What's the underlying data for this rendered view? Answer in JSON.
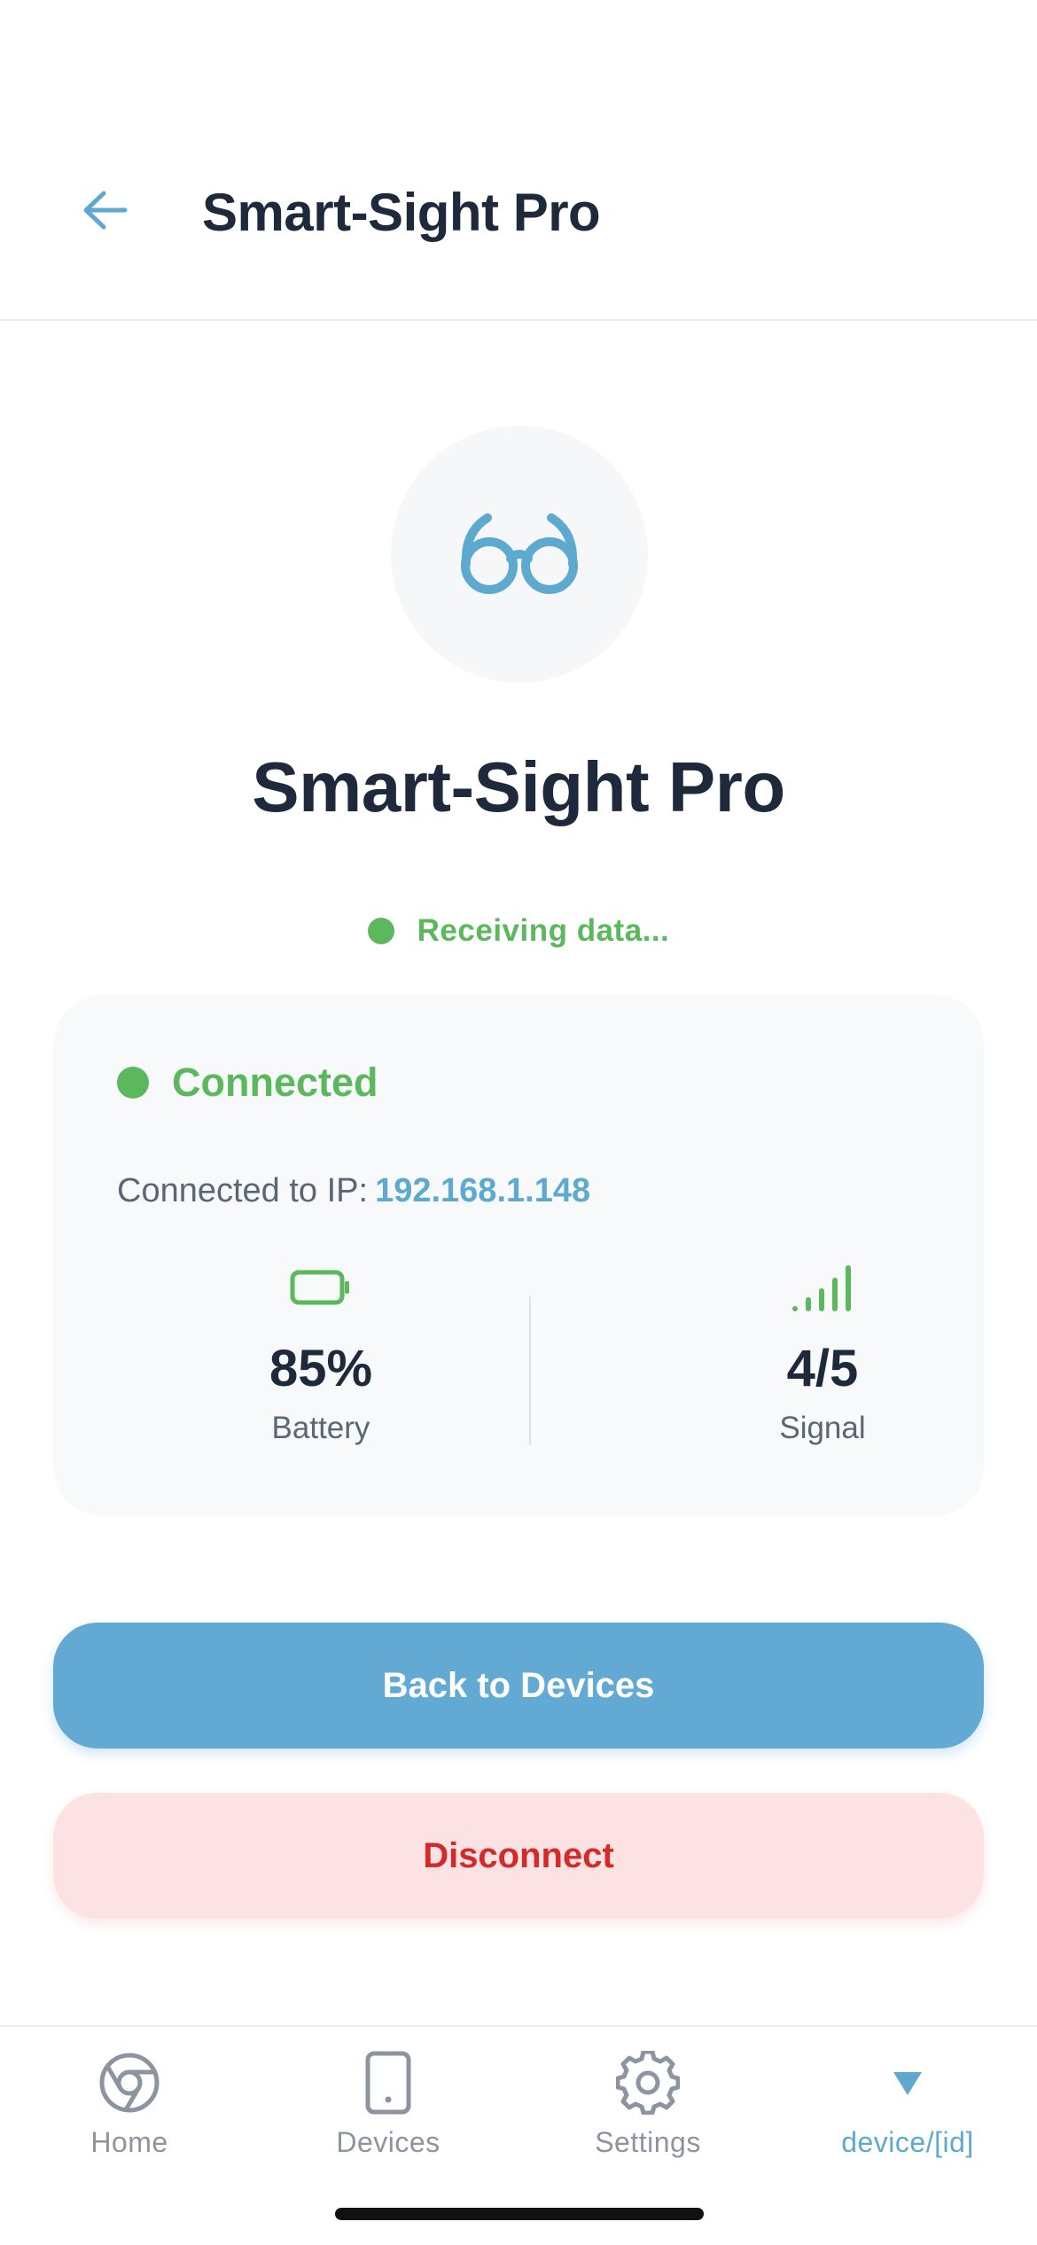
{
  "header": {
    "title": "Smart-Sight Pro",
    "back_icon": "arrow-left-icon"
  },
  "device": {
    "icon": "glasses-icon",
    "name": "Smart-Sight Pro",
    "data_status": "Receiving data..."
  },
  "status_card": {
    "connection_status": "Connected",
    "ip_label": "Connected to IP:",
    "ip_value": "192.168.1.148",
    "battery": {
      "icon": "battery-icon",
      "value": "85%",
      "label": "Battery",
      "level": 0.85
    },
    "signal": {
      "icon": "signal-bars-icon",
      "value": "4/5",
      "label": "Signal",
      "bars": 4,
      "max_bars": 5
    }
  },
  "actions": {
    "back_label": "Back to Devices",
    "disconnect_label": "Disconnect"
  },
  "tabbar": {
    "tabs": [
      {
        "label": "Home",
        "icon": "chrome-icon",
        "active": false
      },
      {
        "label": "Devices",
        "icon": "phone-icon",
        "active": false
      },
      {
        "label": "Settings",
        "icon": "gear-icon",
        "active": false
      },
      {
        "label": "device/[id]",
        "icon": "triangle-down-icon",
        "active": true
      }
    ]
  },
  "colors": {
    "accent": "#62aad3",
    "success": "#5cb85c",
    "danger": "#d42a2a",
    "danger_bg": "#fce2e2",
    "text": "#1e293b",
    "muted": "#8c959f"
  }
}
